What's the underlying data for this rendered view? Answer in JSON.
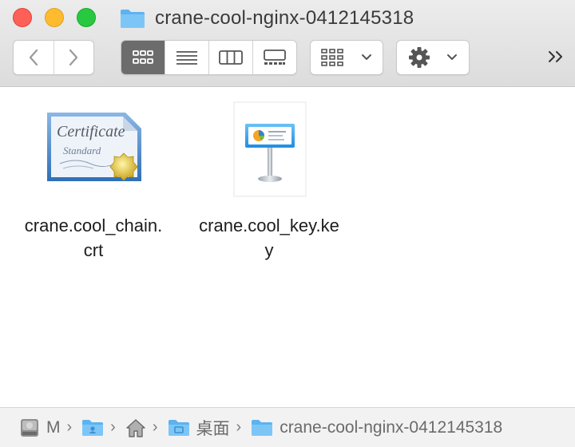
{
  "window": {
    "title": "crane-cool-nginx-0412145318"
  },
  "toolbar": {
    "back_icon": "chevron-left-icon",
    "forward_icon": "chevron-right-icon",
    "view_modes": [
      "icon-view",
      "list-view",
      "column-view",
      "gallery-view"
    ],
    "active_view": "icon-view",
    "group_icon": "group-grid-icon",
    "action_icon": "gear-icon",
    "overflow_icon": "double-chevron-right-icon"
  },
  "files": [
    {
      "name": "crane.cool_chain.crt",
      "name_line1": "crane.cool_chain.",
      "name_line2": "crt",
      "icon": "certificate-icon"
    },
    {
      "name": "crane.cool_key.key",
      "name_line1": "crane.cool_key.ke",
      "name_line2": "y",
      "icon": "keynote-icon"
    }
  ],
  "pathbar": {
    "items": [
      {
        "label": "M",
        "icon": "hard-drive-icon"
      },
      {
        "label": "",
        "icon": "user-folder-icon"
      },
      {
        "label": "",
        "icon": "home-icon"
      },
      {
        "label": "桌面",
        "icon": "desktop-folder-icon"
      },
      {
        "label": "crane-cool-nginx-0412145318",
        "icon": "folder-icon"
      }
    ],
    "separator": "›"
  },
  "colors": {
    "folder_blue": "#5cb3f0",
    "active_segment": "#6c6c6c",
    "close": "#fe5f57",
    "minimize": "#febb2e",
    "maximize": "#28c840"
  }
}
